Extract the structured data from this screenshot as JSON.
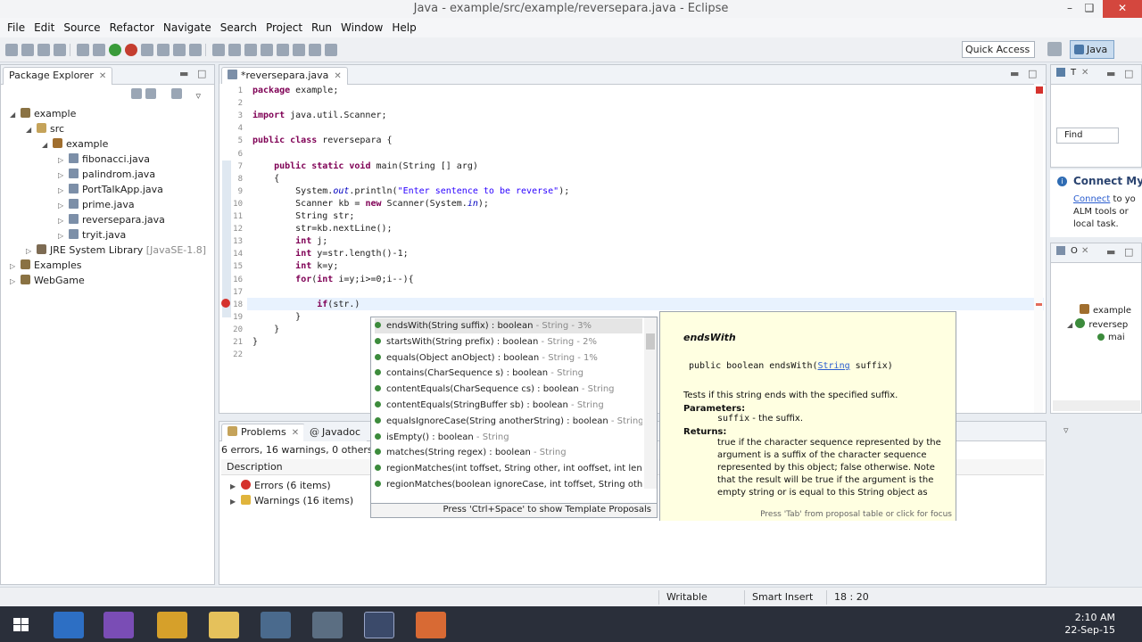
{
  "window": {
    "title": "Java - example/src/example/reversepara.java - Eclipse"
  },
  "menu": [
    "File",
    "Edit",
    "Source",
    "Refactor",
    "Navigate",
    "Search",
    "Project",
    "Run",
    "Window",
    "Help"
  ],
  "toolbar": {
    "quick_access": "Quick Access",
    "perspective": "Java"
  },
  "package_explorer": {
    "tab": "Package Explorer",
    "tree": [
      {
        "label": "example",
        "kind": "proj",
        "depth": 0,
        "open": true
      },
      {
        "label": "src",
        "kind": "src",
        "depth": 1,
        "open": true
      },
      {
        "label": "example",
        "kind": "pkg",
        "depth": 2,
        "open": true
      },
      {
        "label": "fibonacci.java",
        "kind": "java",
        "depth": 3
      },
      {
        "label": "palindrom.java",
        "kind": "java",
        "depth": 3
      },
      {
        "label": "PortTalkApp.java",
        "kind": "java",
        "depth": 3
      },
      {
        "label": "prime.java",
        "kind": "java",
        "depth": 3
      },
      {
        "label": "reversepara.java",
        "kind": "java",
        "depth": 3
      },
      {
        "label": "tryit.java",
        "kind": "java",
        "depth": 3
      },
      {
        "label": "JRE System Library",
        "suffix": "[JavaSE-1.8]",
        "kind": "lib",
        "depth": 1
      },
      {
        "label": "Examples",
        "kind": "proj",
        "depth": 0
      },
      {
        "label": "WebGame",
        "kind": "proj",
        "depth": 0
      }
    ]
  },
  "editor": {
    "tab": "*reversepara.java",
    "lines": [
      {
        "n": "1",
        "html": "<span class='kw'>package</span> example;"
      },
      {
        "n": "2",
        "html": ""
      },
      {
        "n": "3",
        "html": "<span class='kw'>import</span> java.util.Scanner;"
      },
      {
        "n": "4",
        "html": ""
      },
      {
        "n": "5",
        "html": "<span class='kw'>public class</span> reversepara {"
      },
      {
        "n": "6",
        "html": ""
      },
      {
        "n": "7",
        "html": "    <span class='kw'>public static void</span> main(String [] arg)"
      },
      {
        "n": "8",
        "html": "    {"
      },
      {
        "n": "9",
        "html": "        System.<span class='fld'>out</span>.println(<span class='str'>\"Enter sentence to be reverse\"</span>);"
      },
      {
        "n": "10",
        "html": "        Scanner kb = <span class='kw'>new</span> Scanner(System.<span class='fld'>in</span>);"
      },
      {
        "n": "11",
        "html": "        String str;"
      },
      {
        "n": "12",
        "html": "        str=kb.nextLine();"
      },
      {
        "n": "13",
        "html": "        <span class='kw'>int</span> j;"
      },
      {
        "n": "14",
        "html": "        <span class='kw'>int</span> y=str.length()-1;"
      },
      {
        "n": "15",
        "html": "        <span class='kw'>int</span> k=y;"
      },
      {
        "n": "16",
        "html": "        <span class='kw'>for</span>(<span class='kw'>int</span> i=y;i>=0;i--){"
      },
      {
        "n": "17",
        "html": ""
      },
      {
        "n": "18",
        "html": "            <span class='kw'>if</span>(str.)"
      },
      {
        "n": "19",
        "html": "        }"
      },
      {
        "n": "20",
        "html": "    }"
      },
      {
        "n": "21",
        "html": "}"
      },
      {
        "n": "22",
        "html": ""
      }
    ]
  },
  "completion": {
    "items": [
      {
        "sig": "endsWith(String suffix) : boolean",
        "src": " - String - 3%"
      },
      {
        "sig": "startsWith(String prefix) : boolean",
        "src": " - String - 2%"
      },
      {
        "sig": "equals(Object anObject) : boolean",
        "src": " - String - 1%"
      },
      {
        "sig": "contains(CharSequence s) : boolean",
        "src": " - String"
      },
      {
        "sig": "contentEquals(CharSequence cs) : boolean",
        "src": " - String"
      },
      {
        "sig": "contentEquals(StringBuffer sb) : boolean",
        "src": " - String"
      },
      {
        "sig": "equalsIgnoreCase(String anotherString) : boolean",
        "src": " - String"
      },
      {
        "sig": "isEmpty() : boolean",
        "src": " - String"
      },
      {
        "sig": "matches(String regex) : boolean",
        "src": " - String"
      },
      {
        "sig": "regionMatches(int toffset, String other, int ooffset, int len)",
        "src": ""
      },
      {
        "sig": "regionMatches(boolean ignoreCase, int toffset, String oth",
        "src": ""
      }
    ],
    "footer": "Press 'Ctrl+Space' to show Template Proposals"
  },
  "javadoc": {
    "name": "endsWith",
    "sig_pre": "public boolean endsWith(",
    "sig_type": "String",
    "sig_post": " suffix)",
    "desc": "Tests if this string ends with the specified suffix.",
    "params_label": "Parameters:",
    "param_name": "suffix",
    "param_desc": " - the suffix.",
    "returns_label": "Returns:",
    "returns_text": "true if the character sequence represented by the argument is a suffix of the character sequence represented by this object; false otherwise. Note that the result will be true if the argument is the empty string or is equal to this String object as determined by the equals(Object) method.",
    "footer": "Press 'Tab' from proposal table or click for focus"
  },
  "problems": {
    "tab": "Problems",
    "tab2": "Javadoc",
    "summary": "6 errors, 16 warnings, 0 others",
    "col": "Description",
    "errors": "Errors (6 items)",
    "warnings": "Warnings (16 items)"
  },
  "right": {
    "find": "Find",
    "connect_title": "Connect Myl",
    "connect_link": "Connect",
    "connect_rest": " to yo",
    "connect_l2": "ALM tools or",
    "connect_l3": "local task.",
    "outline1": "example",
    "outline2": "reversep",
    "outline3": "mai"
  },
  "status": {
    "writable": "Writable",
    "insert": "Smart Insert",
    "pos": "18 : 20"
  },
  "clock": {
    "time": "2:10 AM",
    "date": "22-Sep-15"
  }
}
